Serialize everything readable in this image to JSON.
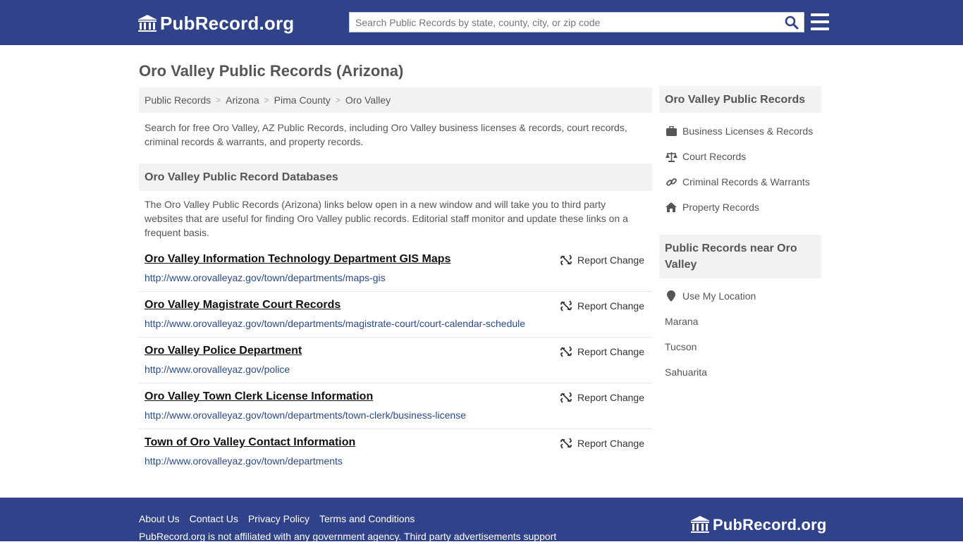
{
  "header": {
    "logo_text": "PubRecord.org",
    "search_placeholder": "Search Public Records by state, county, city, or zip code"
  },
  "page": {
    "title": "Oro Valley Public Records (Arizona)",
    "breadcrumb": [
      "Public Records",
      "Arizona",
      "Pima County",
      "Oro Valley"
    ],
    "intro": "Search for free Oro Valley, AZ Public Records, including Oro Valley business licenses & records, court records, criminal records & warrants, and property records.",
    "section_title": "Oro Valley Public Record Databases",
    "section_desc": "The Oro Valley Public Records (Arizona) links below open in a new window and will take you to third party websites that are useful for finding Oro Valley public records. Editorial staff monitor and update these links on a frequent basis."
  },
  "links": [
    {
      "title": "Oro Valley Information Technology Department GIS Maps",
      "url": "http://www.orovalleyaz.gov/town/departments/maps-gis",
      "report": "Report Change"
    },
    {
      "title": "Oro Valley Magistrate Court Records",
      "url": "http://www.orovalleyaz.gov/town/departments/magistrate-court/court-calendar-schedule",
      "report": "Report Change"
    },
    {
      "title": "Oro Valley Police Department",
      "url": "http://www.orovalleyaz.gov/police",
      "report": "Report Change"
    },
    {
      "title": "Oro Valley Town Clerk License Information",
      "url": "http://www.orovalleyaz.gov/town/departments/town-clerk/business-license",
      "report": "Report Change"
    },
    {
      "title": "Town of Oro Valley Contact Information",
      "url": "http://www.orovalleyaz.gov/town/departments",
      "report": "Report Change"
    }
  ],
  "sidebar": {
    "records_title": "Oro Valley Public Records",
    "records": [
      {
        "label": "Business Licenses & Records",
        "icon": "briefcase-icon"
      },
      {
        "label": "Court Records",
        "icon": "balance-scale-icon"
      },
      {
        "label": "Criminal Records & Warrants",
        "icon": "link-icon"
      },
      {
        "label": "Property Records",
        "icon": "home-icon"
      }
    ],
    "nearby_title": "Public Records near Oro Valley",
    "use_location": "Use My Location",
    "nearby": [
      "Marana",
      "Tucson",
      "Sahuarita"
    ]
  },
  "footer": {
    "links": [
      "About Us",
      "Contact Us",
      "Privacy Policy",
      "Terms and Conditions"
    ],
    "note": "PubRecord.org is not affiliated with any government agency. Third party advertisements support",
    "logo_text": "PubRecord.org"
  },
  "colors": {
    "header_bg": "#304289",
    "panel_bg": "#f2f2f2",
    "link_url": "#2a4a8a"
  }
}
